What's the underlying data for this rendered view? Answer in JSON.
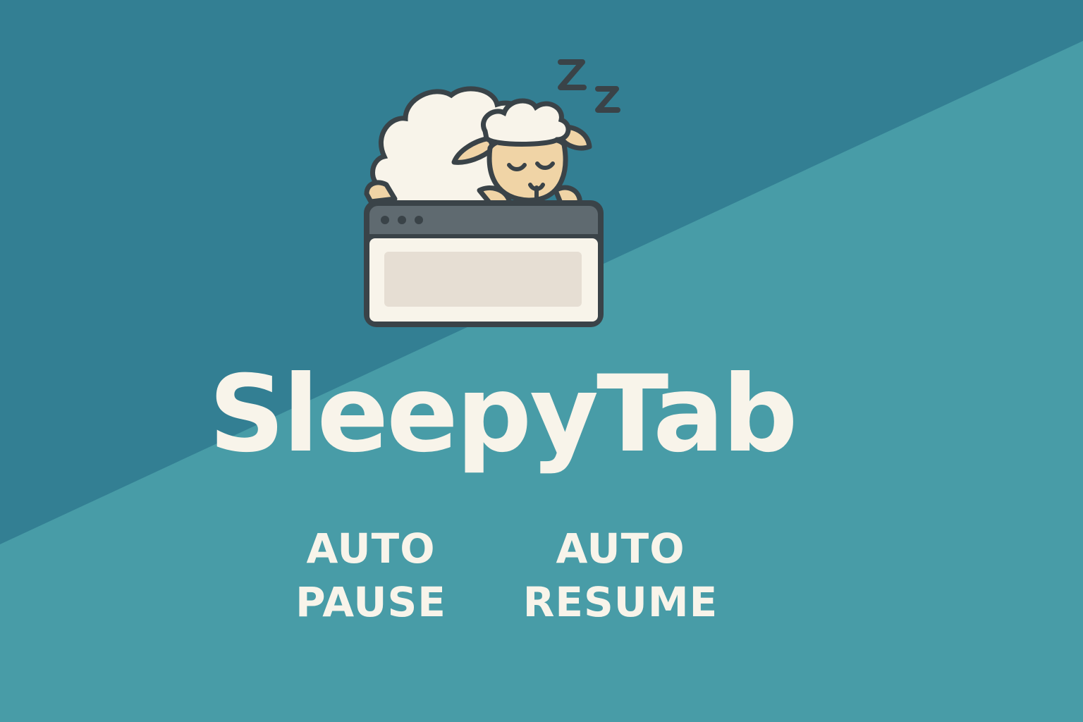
{
  "brand": {
    "name": "SleepyTab",
    "text_color": "#f8f4ea"
  },
  "background": {
    "top_color": "#337f93",
    "bottom_color": "#489ca7"
  },
  "logo": {
    "icon": "sleeping-sheep-on-browser-window-icon",
    "sleep_text": "Z Z",
    "window_frame_color": "#3a4348",
    "window_bar_color": "#5f6a70",
    "window_body_color": "#f8f4ea",
    "window_panel_color": "#e6ded3",
    "wool_color": "#f8f4ea",
    "face_color": "#f0d4a6"
  },
  "features": [
    {
      "line1": "AUTO",
      "line2": "PAUSE"
    },
    {
      "line1": "AUTO",
      "line2": "RESUME"
    }
  ]
}
